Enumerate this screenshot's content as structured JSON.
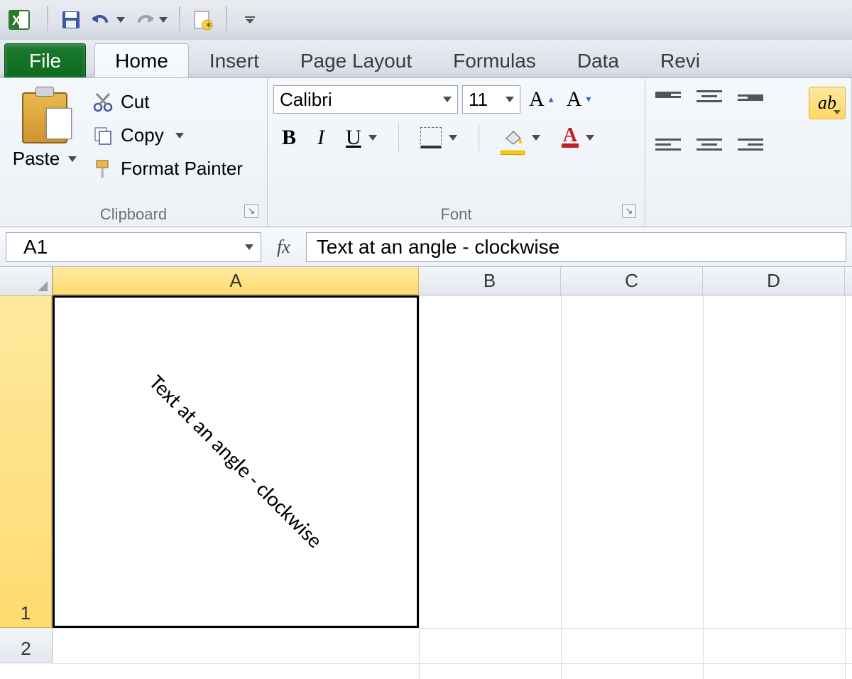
{
  "qat": {
    "save_icon": "save-icon",
    "undo_icon": "undo-icon",
    "redo_icon": "redo-icon",
    "new_icon": "new-icon"
  },
  "tabs": {
    "file": "File",
    "items": [
      {
        "label": "Home",
        "active": true
      },
      {
        "label": "Insert",
        "active": false
      },
      {
        "label": "Page Layout",
        "active": false
      },
      {
        "label": "Formulas",
        "active": false
      },
      {
        "label": "Data",
        "active": false
      },
      {
        "label": "Revi",
        "active": false
      }
    ]
  },
  "ribbon": {
    "clipboard": {
      "label": "Clipboard",
      "paste": "Paste",
      "cut": "Cut",
      "copy": "Copy",
      "format_painter": "Format Painter"
    },
    "font": {
      "label": "Font",
      "name": "Calibri",
      "size": "11",
      "bold": "B",
      "italic": "I",
      "underline": "U",
      "grow": "A",
      "shrink": "A",
      "color_letter": "A"
    },
    "alignment": {
      "label": ""
    }
  },
  "formula_bar": {
    "cell_ref": "A1",
    "fx": "fx",
    "content": "Text at an angle - clockwise"
  },
  "grid": {
    "columns": [
      "A",
      "B",
      "C",
      "D"
    ],
    "rows": [
      "1",
      "2"
    ],
    "A1_text": "Text at an angle - clockwise"
  }
}
